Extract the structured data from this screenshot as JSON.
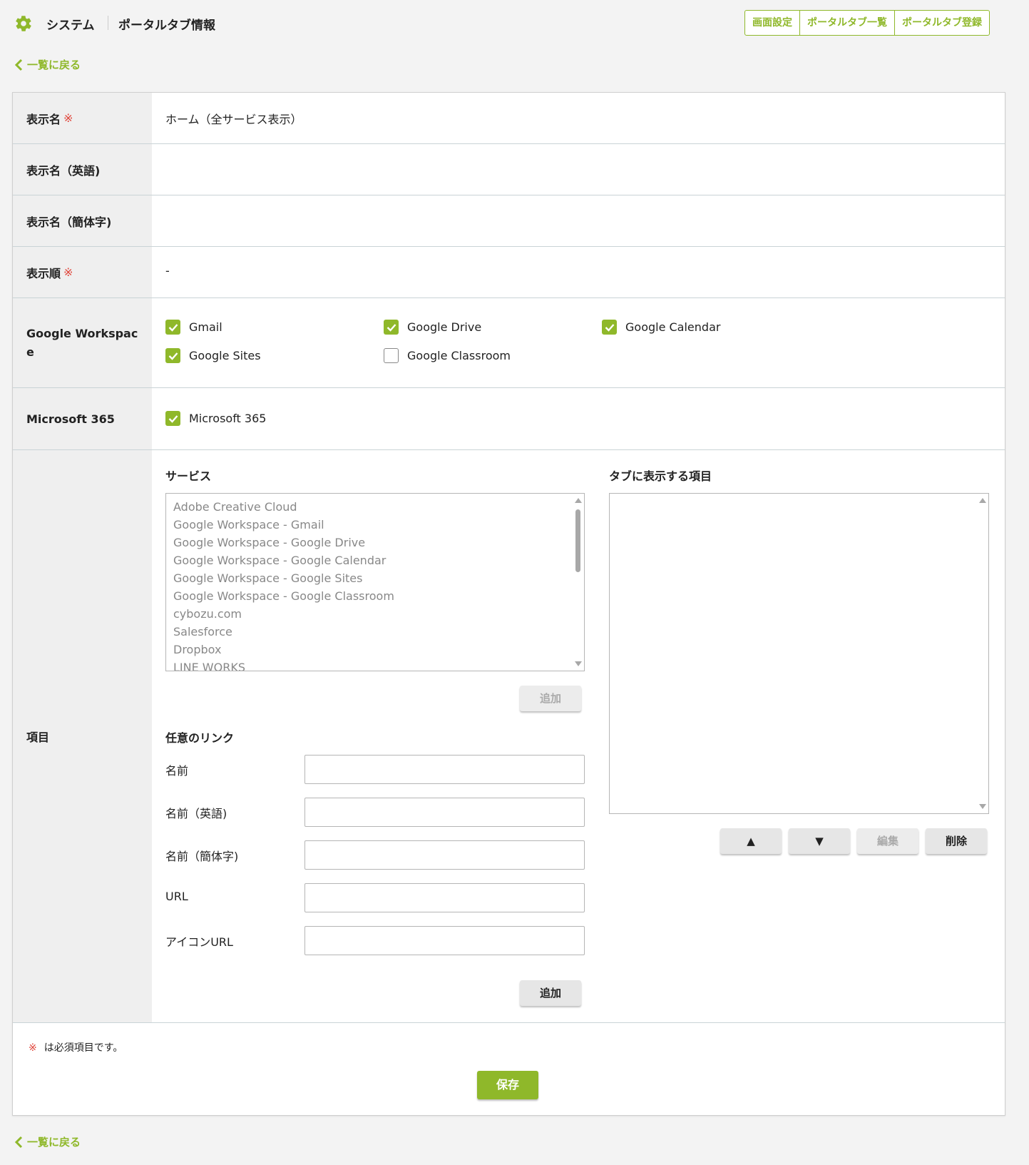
{
  "header": {
    "system_label": "システム",
    "page_title": "ポータルタブ情報",
    "tabs": [
      {
        "label": "画面設定"
      },
      {
        "label": "ポータルタブ一覧"
      },
      {
        "label": "ポータルタブ登録"
      }
    ]
  },
  "back_link": "一覧に戻る",
  "rows": {
    "display_name": {
      "label": "表示名",
      "required_mark": "※",
      "value": "ホーム（全サービス表示）"
    },
    "display_name_en": {
      "label": "表示名（英語)",
      "value": ""
    },
    "display_name_zh": {
      "label": "表示名（簡体字)",
      "value": ""
    },
    "display_order": {
      "label": "表示順",
      "required_mark": "※",
      "value": "-"
    },
    "google_workspace": {
      "label_line1": "Google Workspac",
      "label_line2": "e",
      "options": [
        {
          "label": "Gmail",
          "checked": true
        },
        {
          "label": "Google Drive",
          "checked": true
        },
        {
          "label": "Google Calendar",
          "checked": true
        },
        {
          "label": "Google Sites",
          "checked": true
        },
        {
          "label": "Google Classroom",
          "checked": false
        }
      ]
    },
    "microsoft_365": {
      "label": "Microsoft 365",
      "options": [
        {
          "label": "Microsoft 365",
          "checked": true
        }
      ]
    },
    "items": {
      "label": "項目",
      "services_title": "サービス",
      "services": [
        "Adobe Creative Cloud",
        "Google Workspace - Gmail",
        "Google Workspace - Google Drive",
        "Google Workspace - Google Calendar",
        "Google Workspace - Google Sites",
        "Google Workspace - Google Classroom",
        "cybozu.com",
        "Salesforce",
        "Dropbox",
        "LINE WORKS"
      ],
      "services_add_label": "追加",
      "tab_items_title": "タブに表示する項目",
      "tab_items": [],
      "up_label": "▲",
      "down_label": "▼",
      "edit_label": "編集",
      "delete_label": "削除",
      "custom_link_title": "任意のリンク",
      "custom_fields": [
        {
          "label": "名前",
          "value": ""
        },
        {
          "label": "名前（英語)",
          "value": ""
        },
        {
          "label": "名前（簡体字)",
          "value": ""
        },
        {
          "label": "URL",
          "value": ""
        },
        {
          "label": "アイコンURL",
          "value": ""
        }
      ],
      "custom_add_label": "追加"
    }
  },
  "footer": {
    "required_mark": "※",
    "required_note": "は必須項目です。",
    "save_label": "保存"
  },
  "colors": {
    "accent": "#8fb82a",
    "required": "#e0453a",
    "label_bg": "#efefef",
    "page_bg": "#f3f3f3"
  }
}
